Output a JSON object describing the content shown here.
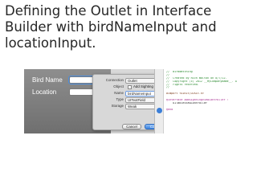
{
  "slide": {
    "title_lines": [
      "Defining the Outlet in Interface",
      "Builder with birdNameInput and",
      "locationInput."
    ]
  },
  "form": {
    "rows": [
      {
        "label": "Bird Name"
      },
      {
        "label": "Location"
      }
    ]
  },
  "popover": {
    "connection": {
      "label": "Connection",
      "value": "Outlet"
    },
    "object": {
      "label": "Object",
      "value": "Add Sighting View"
    },
    "name": {
      "label": "Name",
      "value": "birdNameInput"
    },
    "type": {
      "label": "Type",
      "value": "UITextField"
    },
    "storage": {
      "label": "Storage",
      "value": "Weak"
    },
    "cancel_label": "Cancel",
    "connect_label": "Connect"
  },
  "editor": {
    "lines": [
      {
        "text": "//  BirdWatching",
        "kind": "comment"
      },
      {
        "text": "//",
        "kind": "comment"
      },
      {
        "text": "//  Created by Rich Walton on 8/7/12.",
        "kind": "comment"
      },
      {
        "text": "//  Copyright (c) 2012 __MyCompanyName__. All",
        "kind": "comment"
      },
      {
        "text": "//  rights reserved.",
        "kind": "comment"
      },
      {
        "text": "//",
        "kind": "comment"
      },
      {
        "text": "",
        "kind": "plain"
      },
      {
        "text": "#import <UIKit/UIKit.h>",
        "kind": "directive"
      },
      {
        "text": "",
        "kind": "plain"
      },
      {
        "text": "@interface AddSightingViewController :",
        "kind": "keyword"
      },
      {
        "text": "    UITableViewController",
        "kind": "plain"
      },
      {
        "text": "",
        "kind": "plain"
      },
      {
        "text": "@end",
        "kind": "keyword"
      }
    ]
  },
  "colors": {
    "title_text": "#262626",
    "comment": "#2a8a2f",
    "keyword": "#a3238c",
    "accent": "#3c7fd8"
  }
}
